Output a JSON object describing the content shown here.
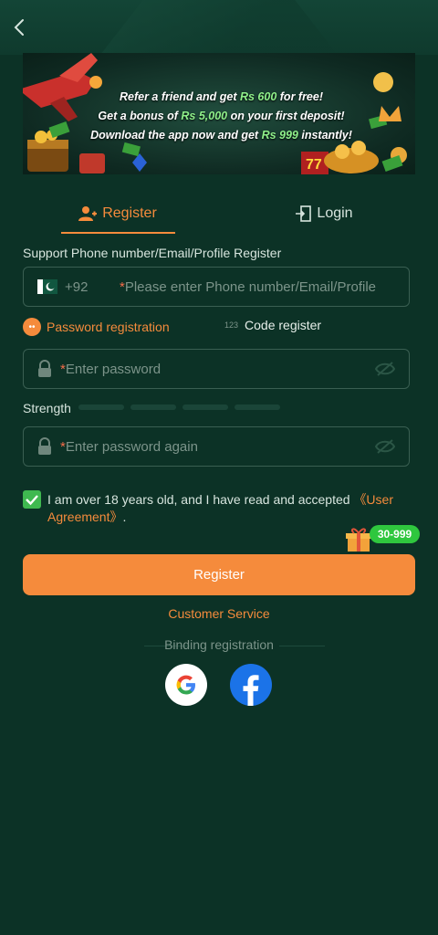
{
  "banner": {
    "line1_pre": "Refer a friend and get ",
    "line1_hl": "Rs 600",
    "line1_post": " for free!",
    "line2_pre": "Get a bonus of ",
    "line2_hl": "Rs 5,000",
    "line2_post": " on your first deposit!",
    "line3_pre": "Download the app now and get ",
    "line3_hl": "Rs 999",
    "line3_post": " instantly!"
  },
  "tabs": {
    "register": "Register",
    "login": "Login"
  },
  "phone": {
    "label": "Support Phone number/Email/Profile Register",
    "code": "+92",
    "placeholder": "Please enter Phone number/Email/Profile"
  },
  "options": {
    "password": "Password registration",
    "code": "Code register",
    "code_icon": "123"
  },
  "password": {
    "placeholder": "Enter password"
  },
  "strength_label": "Strength",
  "confirm": {
    "placeholder": "Enter password again"
  },
  "agreement": {
    "text": "I am over 18 years old, and I have read and accepted ",
    "link": "《User Agreement》",
    "end": "."
  },
  "promo_badge": "30-999",
  "register_button": "Register",
  "customer_service": "Customer Service",
  "binding": "Binding registration",
  "colors": {
    "accent": "#f58b3c",
    "background": "#0c3226",
    "checkbox": "#3fb950",
    "facebook": "#1b73e8"
  },
  "icons": [
    "back-icon",
    "user-add-icon",
    "login-icon",
    "pakistan-flag-icon",
    "lock-icon",
    "eye-off-icon",
    "gift-icon",
    "google-icon",
    "facebook-icon"
  ]
}
